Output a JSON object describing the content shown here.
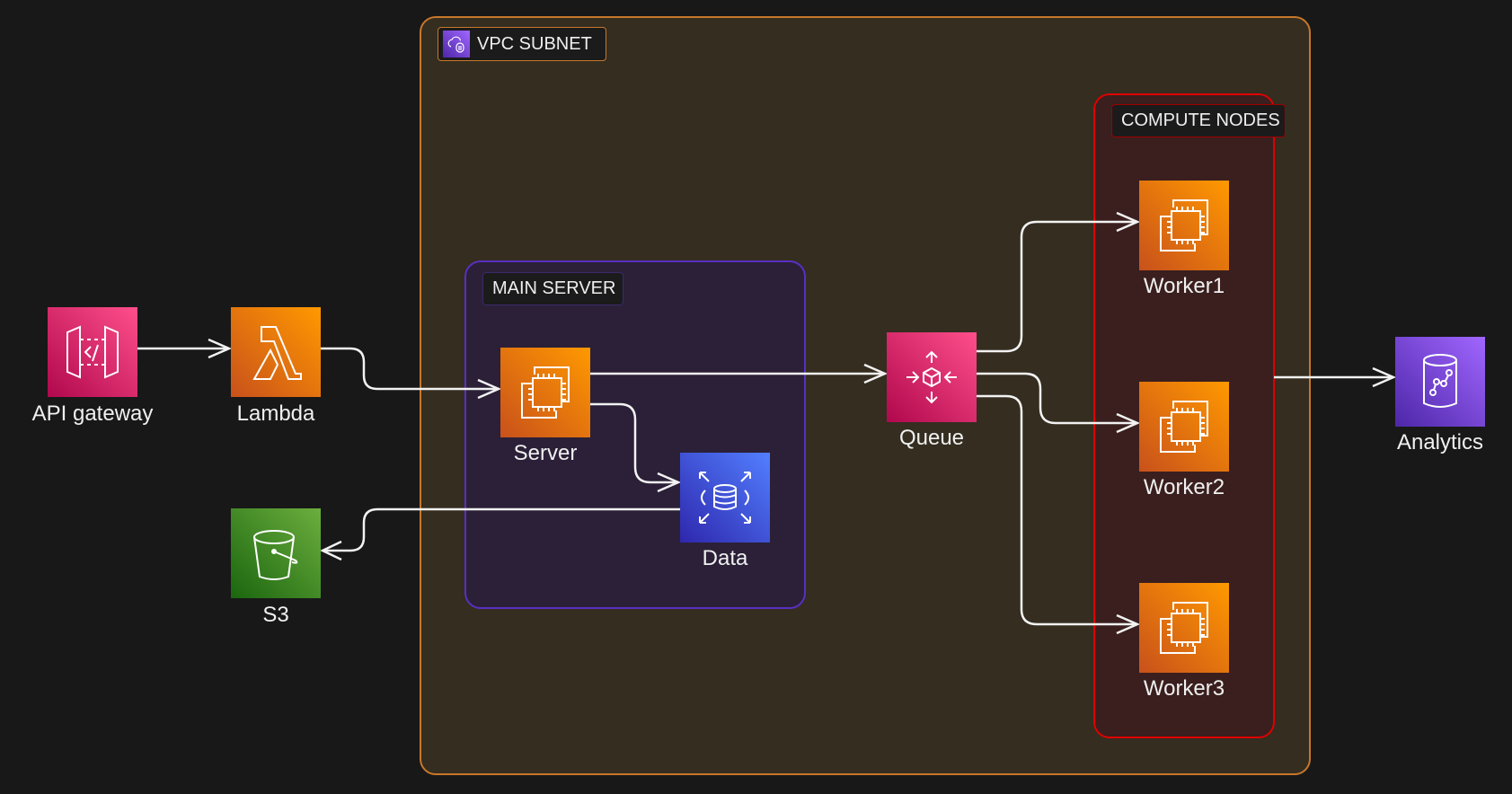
{
  "groups": {
    "vpc": {
      "label": "VPC SUBNET",
      "icon": "vpc-cloud-icon",
      "border_color": "#c7772a"
    },
    "main_server": {
      "label": "MAIN SERVER",
      "border_color": "#5a2fc2"
    },
    "compute_nodes": {
      "label": "COMPUTE NODES",
      "border_color": "#e00000"
    }
  },
  "nodes": {
    "api_gateway": {
      "label": "API gateway",
      "icon": "api-gateway-icon",
      "color": "#e7157b"
    },
    "lambda": {
      "label": "Lambda",
      "icon": "lambda-icon",
      "color": "#ed7100"
    },
    "s3": {
      "label": "S3",
      "icon": "s3-bucket-icon",
      "color": "#3f8624"
    },
    "server": {
      "label": "Server",
      "icon": "ec2-instance-icon",
      "color": "#ed7100"
    },
    "data": {
      "label": "Data",
      "icon": "database-icon",
      "color": "#3b48cc"
    },
    "queue": {
      "label": "Queue",
      "icon": "queue-icon",
      "color": "#e7157b"
    },
    "worker1": {
      "label": "Worker1",
      "icon": "ec2-instance-icon",
      "color": "#ed7100"
    },
    "worker2": {
      "label": "Worker2",
      "icon": "ec2-instance-icon",
      "color": "#ed7100"
    },
    "worker3": {
      "label": "Worker3",
      "icon": "ec2-instance-icon",
      "color": "#ed7100"
    },
    "analytics": {
      "label": "Analytics",
      "icon": "analytics-icon",
      "color": "#8c4fff"
    }
  },
  "edges": [
    {
      "from": "API gateway",
      "to": "Lambda"
    },
    {
      "from": "Lambda",
      "to": "Server"
    },
    {
      "from": "Server",
      "to": "Queue"
    },
    {
      "from": "Server",
      "to": "Data"
    },
    {
      "from": "Data",
      "to": "S3"
    },
    {
      "from": "Queue",
      "to": "Worker1"
    },
    {
      "from": "Queue",
      "to": "Worker2"
    },
    {
      "from": "Queue",
      "to": "Worker3"
    },
    {
      "from": "COMPUTE NODES",
      "to": "Analytics"
    }
  ]
}
